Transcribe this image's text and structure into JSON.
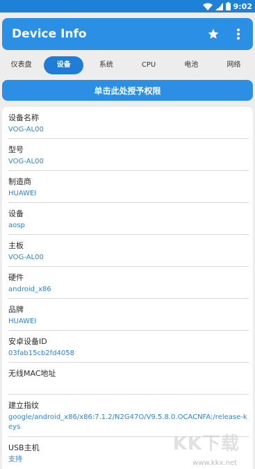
{
  "status_bar": {
    "time": "9:02",
    "wifi_icon": "wifi-icon",
    "signal_icon": "signal-icon",
    "battery_icon": "battery-icon"
  },
  "app_bar": {
    "title": "Device Info",
    "favorite_icon": "star-icon",
    "menu_icon": "more-vert-icon"
  },
  "tabs": [
    {
      "label": "仪表盘",
      "active": false
    },
    {
      "label": "设备",
      "active": true
    },
    {
      "label": "系统",
      "active": false
    },
    {
      "label": "CPU",
      "active": false
    },
    {
      "label": "电池",
      "active": false
    },
    {
      "label": "网络",
      "active": false
    }
  ],
  "grant_button": {
    "label": "单击此处授予权限"
  },
  "items": [
    {
      "label": "设备名称",
      "value": "VOG-AL00"
    },
    {
      "label": "型号",
      "value": "VOG-AL00"
    },
    {
      "label": "制造商",
      "value": "HUAWEI"
    },
    {
      "label": "设备",
      "value": "aosp"
    },
    {
      "label": "主板",
      "value": "VOG-AL00"
    },
    {
      "label": "硬件",
      "value": "android_x86"
    },
    {
      "label": "品牌",
      "value": "HUAWEI"
    },
    {
      "label": "安卓设备ID",
      "value": "03fab15cb2fd4058"
    },
    {
      "label": "无线MAC地址",
      "value": ""
    },
    {
      "label": "建立指纹",
      "value": "google/android_x86/x86:7.1.2/N2G47O/V9.5.8.0.OCACNFA:/release-keys"
    },
    {
      "label": "USB主机",
      "value": "支持"
    }
  ],
  "watermark": {
    "text": "KK下载",
    "url": "www.kkx.net"
  },
  "colors": {
    "accent": "#2b8fe6",
    "value_text": "#2f84d1",
    "background": "#ededed"
  }
}
